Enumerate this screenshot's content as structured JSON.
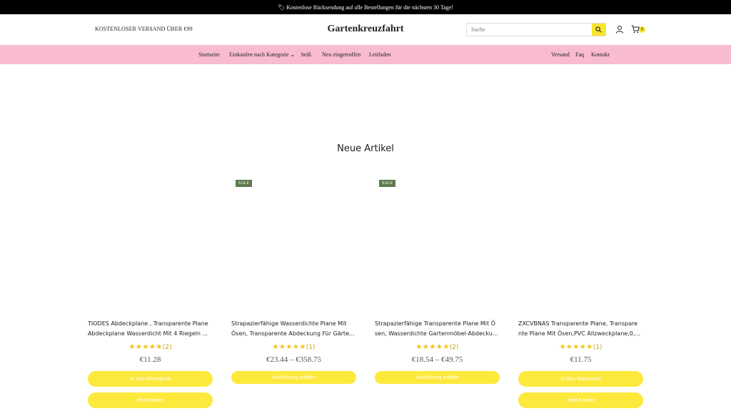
{
  "announcement": "🏷 Kostenlose Rücksendung auf alle Bestellungen für die nächsten 30 Tage!",
  "header": {
    "shipping_note": "KOSTENLOSER VERSAND ÜBER €99",
    "brand": "Gartenkreuzfahrt",
    "search_placeholder": "Suche",
    "cart_count": "0"
  },
  "nav": {
    "left": [
      "Startseite",
      "Einkaufen nach Kategorie ⌄",
      "heiß",
      "Neu eingetroffen",
      "Leitfaden"
    ],
    "right": [
      "Versand",
      "Faq",
      "Kontakt"
    ]
  },
  "section_title": "Neue Artikel",
  "products": [
    {
      "badge": "",
      "title_line1": "TIODES Abdeckplane , Transparente Plane",
      "title_line2": "Abdeckplane Wasserdicht Mit 4 Riegeln ...",
      "stars": "★★★★★",
      "reviews": "(2)",
      "price": "€11.28",
      "btn1": "In Den Warenkorb",
      "btn2": "Jetzt Kaufen"
    },
    {
      "badge": "SALE",
      "title_line1": "Strapazierfähige Wasserdichte Plane Mit",
      "title_line2": "Ösen, Transparente Abdeckung Für Gärte...",
      "stars": "★★★★★",
      "reviews": "(1)",
      "price": "€23.44 – €358.75",
      "btn1": "Ausführung wählen",
      "btn2": ""
    },
    {
      "badge": "SALE",
      "title_line1": "Strapazierfähige Transparente Plane Mit Ö",
      "title_line2": "sen, Wasserdichte Gartenmöbel-Abdecku...",
      "stars": "★★★★★",
      "reviews": "(2)",
      "price": "€18.54 – €49.75",
      "btn1": "Ausführung wählen",
      "btn2": ""
    },
    {
      "badge": "",
      "title_line1": "ZXCVBNAS Transparente Plane, Transpare",
      "title_line2": "nte Plane Mit Ösen,PVC Allzweckplane,0,...",
      "stars": "★★★★★",
      "reviews": "(1)",
      "price": "€11.75",
      "btn1": "In Den Warenkorb",
      "btn2": "Jetzt Kaufen"
    }
  ],
  "colors": {
    "announcement_bg": "#000000",
    "nav_bg": "#f8bbd0",
    "button_bg": "#fde93c",
    "sale_badge_bg": "#5d7a4e",
    "star_color": "#f0c419"
  }
}
